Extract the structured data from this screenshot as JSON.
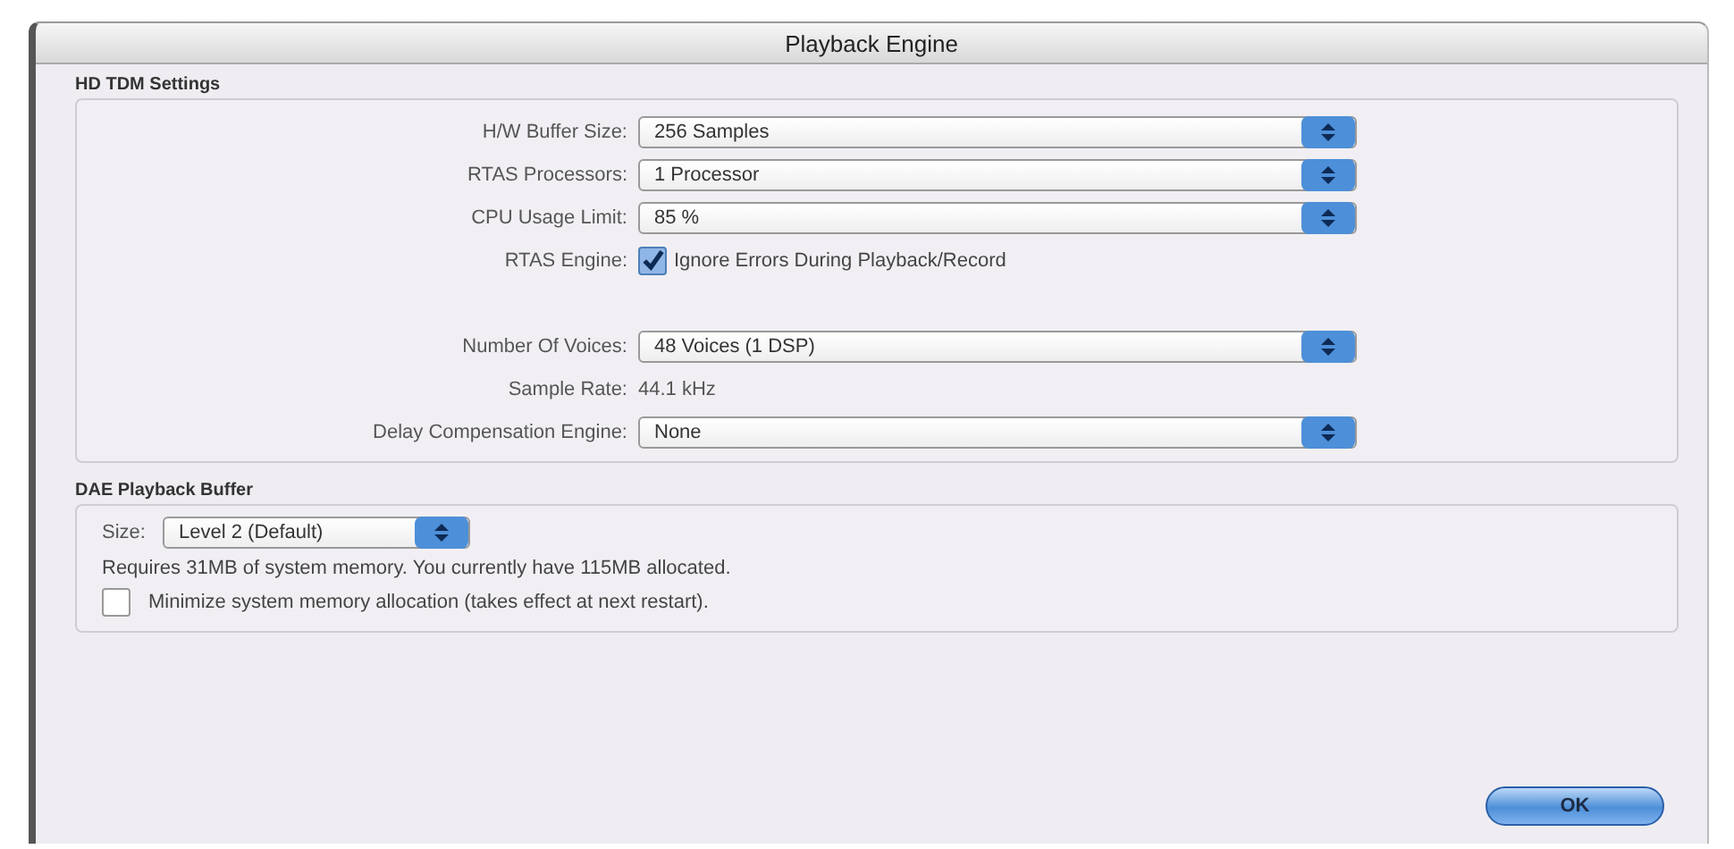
{
  "window": {
    "title": "Playback Engine"
  },
  "hd_tdm_settings": {
    "title": "HD TDM Settings",
    "rows": [
      {
        "kind": "select",
        "label": "H/W Buffer Size:",
        "value": "256 Samples"
      },
      {
        "kind": "select",
        "label": "RTAS Processors:",
        "value": "1 Processor"
      },
      {
        "kind": "select",
        "label": "CPU Usage Limit:",
        "value": "85 %"
      },
      {
        "kind": "checkbox",
        "label": "RTAS Engine:",
        "text": "Ignore Errors During Playback/Record",
        "checked": true
      },
      {
        "kind": "select",
        "label": "Number Of Voices:",
        "value": "48 Voices (1 DSP)"
      },
      {
        "kind": "text",
        "label": "Sample Rate:",
        "value": "44.1 kHz"
      },
      {
        "kind": "select",
        "label": "Delay Compensation Engine:",
        "value": "None"
      }
    ]
  },
  "dae_playback_buffer": {
    "title": "DAE Playback Buffer",
    "size_label": "Size:",
    "size_value": "Level 2 (Default)",
    "note": "Requires 31MB of system memory. You currently have 115MB allocated.",
    "minimize": {
      "text": "Minimize system memory allocation (takes effect at next restart).",
      "checked": false
    }
  },
  "buttons": [
    {
      "label": "OK"
    }
  ]
}
